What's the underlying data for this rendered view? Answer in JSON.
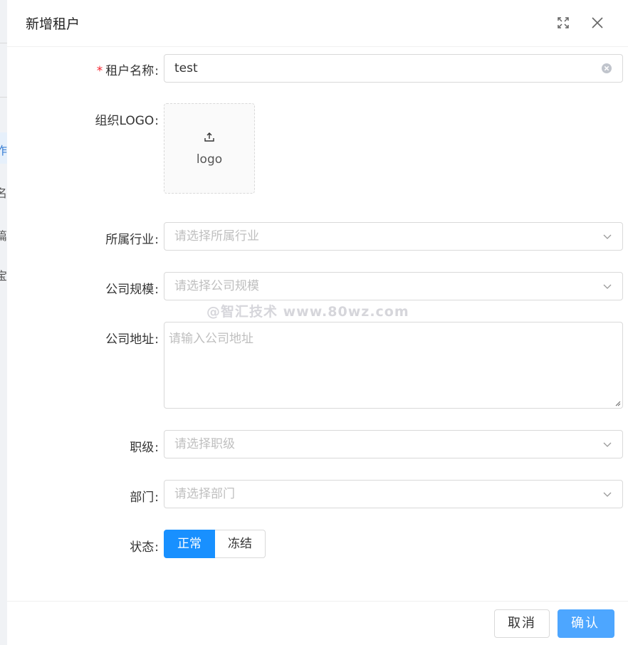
{
  "modal": {
    "title": "新增租户"
  },
  "background": {
    "chars": [
      "作",
      "名",
      "篇",
      "宝"
    ]
  },
  "form": {
    "tenant_name": {
      "label": "租户名称",
      "value": "test",
      "required": true
    },
    "org_logo": {
      "label": "组织LOGO",
      "upload_text": "logo"
    },
    "industry": {
      "label": "所属行业",
      "placeholder": "请选择所属行业"
    },
    "company_size": {
      "label": "公司规模",
      "placeholder": "请选择公司规模"
    },
    "company_address": {
      "label": "公司地址",
      "placeholder": "请输入公司地址"
    },
    "job_level": {
      "label": "职级",
      "placeholder": "请选择职级"
    },
    "department": {
      "label": "部门",
      "placeholder": "请选择部门"
    },
    "status": {
      "label": "状态",
      "options": [
        "正常",
        "冻结"
      ],
      "selected": "正常"
    }
  },
  "watermark": "@智汇技术 www.80wz.com",
  "footer": {
    "cancel_label": "取消",
    "ok_label": "确认"
  },
  "colors": {
    "primary": "#1890ff",
    "ok_button": "#4da6ff",
    "required": "#f5222d",
    "placeholder": "#bfbfbf"
  }
}
